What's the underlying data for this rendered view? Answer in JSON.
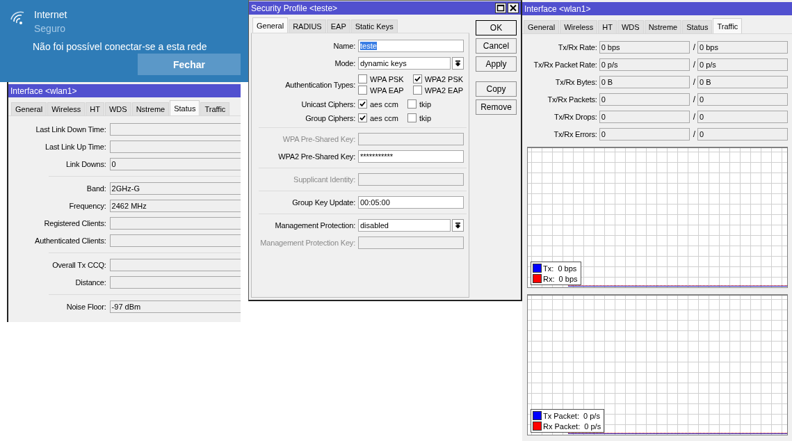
{
  "notification": {
    "title": "Internet",
    "subtitle": "Seguro",
    "message": "Não foi possível conectar-se a esta rede",
    "button": "Fechar"
  },
  "status_window": {
    "title": "Interface <wlan1>",
    "tabs": [
      {
        "label": "General",
        "selected": false
      },
      {
        "label": "Wireless",
        "selected": false
      },
      {
        "label": "HT",
        "selected": false
      },
      {
        "label": "WDS",
        "selected": false
      },
      {
        "label": "Nstreme",
        "selected": false
      },
      {
        "label": "Status",
        "selected": true
      },
      {
        "label": "Traffic",
        "selected": false
      }
    ],
    "groups": [
      [
        {
          "label": "Last Link Down Time:"
        },
        {
          "label": "Last Link Up Time:"
        },
        {
          "label": "Link Downs:",
          "value": "0"
        }
      ],
      [
        {
          "label": "Band:",
          "value": "2GHz-G"
        },
        {
          "label": "Frequency:",
          "value": "2462 MHz"
        },
        {
          "label": "Registered Clients:"
        },
        {
          "label": "Authenticated Clients:"
        }
      ],
      [
        {
          "label": "Overall Tx CCQ:"
        },
        {
          "label": "Distance:"
        }
      ],
      [
        {
          "label": "Noise Floor:",
          "value": "-97 dBm"
        }
      ]
    ]
  },
  "security_window": {
    "title": "Security Profile <teste>",
    "tabs": [
      {
        "label": "General",
        "selected": true
      },
      {
        "label": "RADIUS",
        "selected": false
      },
      {
        "label": "EAP",
        "selected": false
      },
      {
        "label": "Static Keys",
        "selected": false
      }
    ],
    "groups": [
      [
        {
          "kind": "text",
          "label": "Name:",
          "value": "teste",
          "disabled": false,
          "highlighted": true
        },
        {
          "kind": "select",
          "label": "Mode:",
          "value": "dynamic keys",
          "disabled": false
        },
        {
          "kind": "checks",
          "label": "Authentication Types:",
          "options": [
            {
              "label": "WPA PSK",
              "checked": false
            },
            {
              "label": "WPA2 PSK",
              "checked": true
            },
            {
              "label": "WPA EAP",
              "checked": false
            },
            {
              "label": "WPA2 EAP",
              "checked": false
            }
          ]
        },
        {
          "kind": "checks",
          "label": "Unicast Ciphers:",
          "options": [
            {
              "label": "aes ccm",
              "checked": true
            },
            {
              "label": "tkip",
              "checked": false
            }
          ]
        },
        {
          "kind": "checks",
          "label": "Group Ciphers:",
          "options": [
            {
              "label": "aes ccm",
              "checked": true
            },
            {
              "label": "tkip",
              "checked": false
            }
          ]
        }
      ],
      [
        {
          "kind": "text",
          "label": "WPA Pre-Shared Key:",
          "disabled": true
        },
        {
          "kind": "text",
          "label": "WPA2 Pre-Shared Key:",
          "value": "***********",
          "disabled": false
        }
      ],
      [
        {
          "kind": "text",
          "label": "Supplicant Identity:",
          "disabled": true
        }
      ],
      [
        {
          "kind": "text",
          "label": "Group Key Update:",
          "value": "00:05:00",
          "disabled": false
        }
      ],
      [
        {
          "kind": "select",
          "label": "Management Protection:",
          "value": "disabled",
          "disabled": false
        },
        {
          "kind": "text",
          "label": "Management Protection Key:",
          "disabled": true
        }
      ]
    ],
    "buttons": [
      {
        "label": "OK",
        "default": true
      },
      {
        "label": "Cancel",
        "default": false
      },
      {
        "label": "Apply",
        "default": false
      },
      {
        "label": "Copy",
        "default": false
      },
      {
        "label": "Remove",
        "default": false
      }
    ]
  },
  "traffic_window": {
    "title": "Interface <wlan1>",
    "tabs": [
      {
        "label": "General",
        "selected": false
      },
      {
        "label": "Wireless",
        "selected": false
      },
      {
        "label": "HT",
        "selected": false
      },
      {
        "label": "WDS",
        "selected": false
      },
      {
        "label": "Nstreme",
        "selected": false
      },
      {
        "label": "Status",
        "selected": false
      },
      {
        "label": "Traffic",
        "selected": true
      }
    ],
    "rows": [
      {
        "label": "Tx/Rx Rate:",
        "tx": "0 bps",
        "separator": "/",
        "rx": "0 bps"
      },
      {
        "label": "Tx/Rx Packet Rate:",
        "tx": "0 p/s",
        "separator": "/",
        "rx": "0 p/s"
      },
      {
        "label": "Tx/Rx Bytes:",
        "tx": "0 B",
        "separator": "/",
        "rx": "0 B"
      },
      {
        "label": "Tx/Rx Packets:",
        "tx": "0",
        "separator": "/",
        "rx": "0"
      },
      {
        "label": "Tx/Rx Drops:",
        "tx": "0",
        "separator": "/",
        "rx": "0"
      },
      {
        "label": "Tx/Rx Errors:",
        "tx": "0",
        "separator": "/",
        "rx": "0"
      }
    ],
    "graphs": [
      {
        "legend": [
          {
            "label": "Tx:  0 bps",
            "color": "#0000ff"
          },
          {
            "label": "Rx:  0 bps",
            "color": "#ff0000"
          }
        ]
      },
      {
        "legend": [
          {
            "label": "Tx Packet:  0 p/s",
            "color": "#0000ff"
          },
          {
            "label": "Rx Packet:  0 p/s",
            "color": "#ff0000"
          }
        ]
      }
    ]
  }
}
